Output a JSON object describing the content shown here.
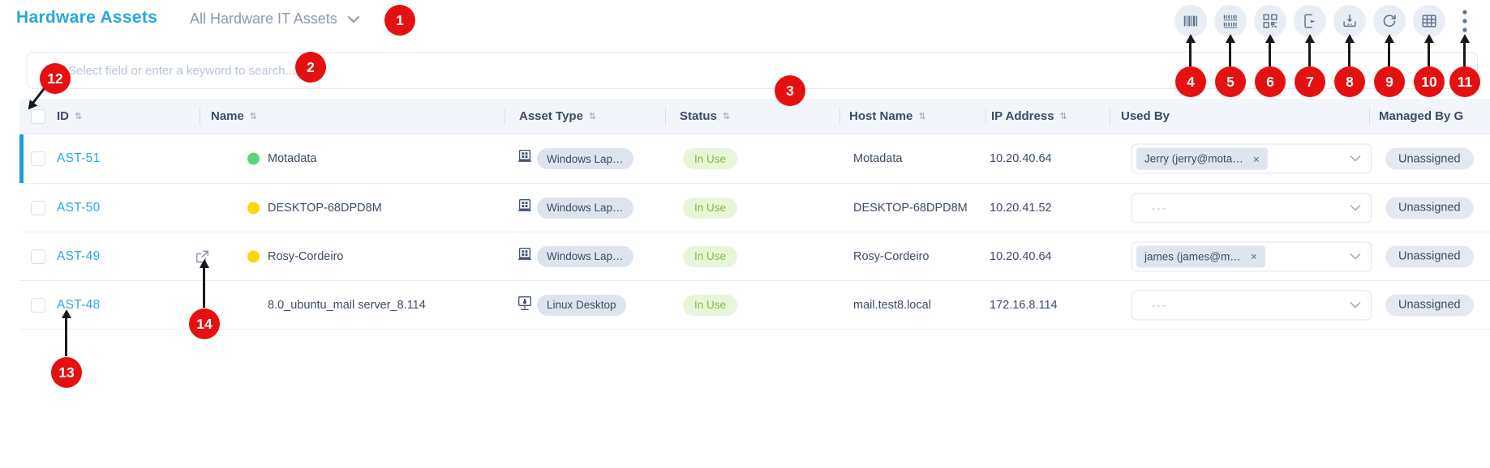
{
  "page": {
    "title": "Hardware Assets",
    "view_selector": "All Hardware IT Assets"
  },
  "search": {
    "placeholder": "Select field or enter a keyword to search..."
  },
  "toolbar": {
    "icons": [
      {
        "name": "barcode-icon"
      },
      {
        "name": "multiple-barcodes-icon"
      },
      {
        "name": "qr-code-icon"
      },
      {
        "name": "export-icon"
      },
      {
        "name": "import-icon"
      },
      {
        "name": "refresh-icon"
      },
      {
        "name": "column-selector-icon"
      },
      {
        "name": "kebab-menu-icon"
      }
    ]
  },
  "table": {
    "sort_glyph": "⇅",
    "columns": [
      {
        "label": "ID",
        "sortable": true
      },
      {
        "label": "Name",
        "sortable": true
      },
      {
        "label": "Asset Type",
        "sortable": true
      },
      {
        "label": "Status",
        "sortable": true
      },
      {
        "label": "Host Name",
        "sortable": true
      },
      {
        "label": "IP Address",
        "sortable": true
      },
      {
        "label": "Used By",
        "sortable": false
      },
      {
        "label": "Managed By G",
        "sortable": false
      }
    ],
    "rows": [
      {
        "id": "AST-51",
        "dot_color": "#5ed37c",
        "name": "Motadata",
        "asset_icon": "windows-laptop-icon",
        "asset_type": "Windows Lap…",
        "status": "In Use",
        "host_name": "Motadata",
        "ip_address": "10.20.40.64",
        "used_by": {
          "chip": "Jerry (jerry@mota…",
          "remove_glyph": "×"
        },
        "managed_by": "Unassigned",
        "selected": true
      },
      {
        "id": "AST-50",
        "dot_color": "#ffd60b",
        "name": "DESKTOP-68DPD8M",
        "asset_icon": "windows-laptop-icon",
        "asset_type": "Windows Lap…",
        "status": "In Use",
        "host_name": "DESKTOP-68DPD8M",
        "ip_address": "10.20.41.52",
        "used_by": {
          "placeholder": "---"
        },
        "managed_by": "Unassigned",
        "selected": false
      },
      {
        "id": "AST-49",
        "dot_color": "#ffd60b",
        "name": "Rosy-Cordeiro",
        "asset_icon": "windows-laptop-icon",
        "asset_type": "Windows Lap…",
        "status": "In Use",
        "host_name": "Rosy-Cordeiro",
        "ip_address": "10.20.40.64",
        "used_by": {
          "chip": "james (james@m…",
          "remove_glyph": "×"
        },
        "managed_by": "Unassigned",
        "selected": false,
        "external_link": true
      },
      {
        "id": "AST-48",
        "name": "8.0_ubuntu_mail server_8.114",
        "asset_icon": "linux-desktop-icon",
        "asset_type": "Linux Desktop",
        "status": "In Use",
        "host_name": "mail.test8.local",
        "ip_address": "172.16.8.114",
        "used_by": {
          "placeholder": "---"
        },
        "managed_by": "Unassigned",
        "selected": false
      }
    ]
  },
  "annotations": {
    "labels": [
      "1",
      "2",
      "3",
      "4",
      "5",
      "6",
      "7",
      "8",
      "9",
      "10",
      "11",
      "12",
      "13",
      "14"
    ]
  },
  "colors": {
    "accent": "#29a9e2",
    "status_in_use": "#7abf40",
    "callout_red": "#e51010",
    "selected_row_bar": "#1a9fe0",
    "dot_green": "#5ed37c",
    "dot_yellow": "#ffd60b"
  }
}
